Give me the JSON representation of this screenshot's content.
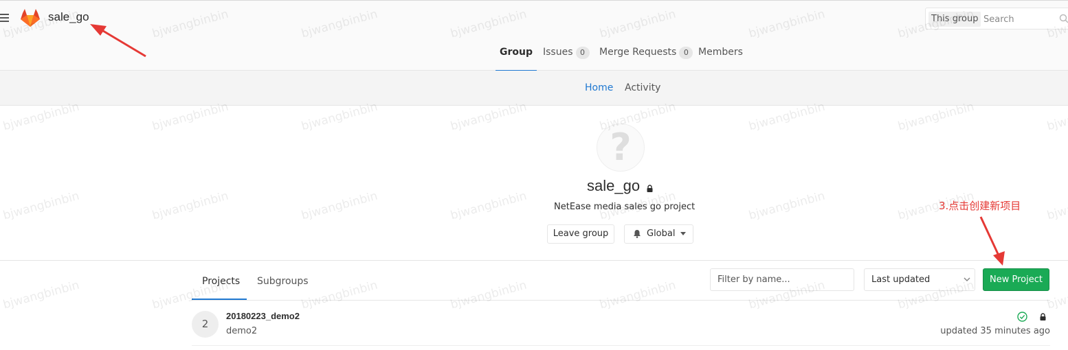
{
  "header": {
    "group_name": "sale_go",
    "search": {
      "scope_label": "This group",
      "placeholder": "Search"
    },
    "tabs": [
      {
        "label": "Group",
        "active": true
      },
      {
        "label": "Issues",
        "count": "0"
      },
      {
        "label": "Merge Requests",
        "count": "0"
      },
      {
        "label": "Members"
      }
    ]
  },
  "subnav": {
    "tabs": [
      {
        "label": "Home",
        "active": true
      },
      {
        "label": "Activity"
      }
    ]
  },
  "group_info": {
    "avatar_glyph": "?",
    "name": "sale_go",
    "description": "NetEase media sales go project",
    "leave_label": "Leave group",
    "notification_label": "Global"
  },
  "projects_section": {
    "tabs": [
      {
        "label": "Projects",
        "active": true
      },
      {
        "label": "Subgroups"
      }
    ],
    "filter_placeholder": "Filter by name...",
    "sort_value": "Last updated",
    "new_project_label": "New Project",
    "items": [
      {
        "avatar_letter": "2",
        "name": "20180223_demo2",
        "description": "demo2",
        "updated": "updated 35 minutes ago"
      }
    ]
  },
  "annotation": {
    "text": "3.点击创建新项目"
  },
  "watermark": {
    "text": "bjwangbinbin"
  },
  "colors": {
    "accent_blue": "#1f78d1",
    "success_green": "#1aaa55",
    "annotation_red": "#e53935"
  }
}
